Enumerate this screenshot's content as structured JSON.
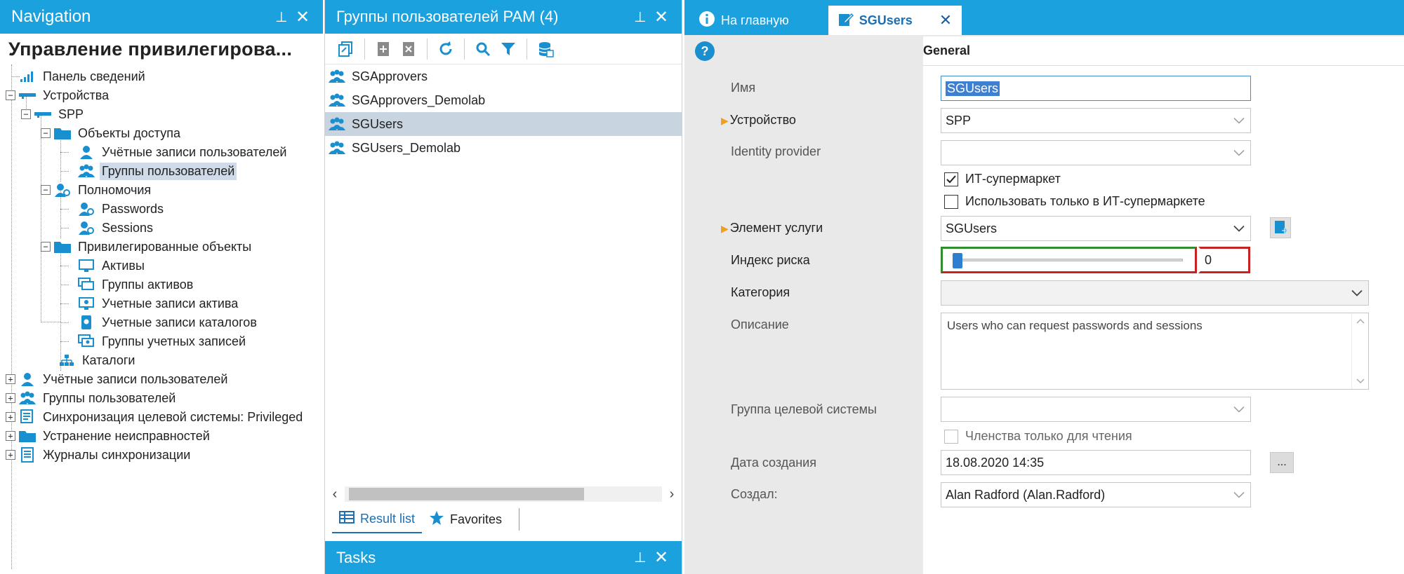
{
  "navigation": {
    "header_title": "Navigation",
    "pin": "⊥",
    "close": "✕",
    "root_title": "Управление привилегирова...",
    "items": [
      {
        "label": "Панель сведений",
        "icon": "dashboard-icon"
      },
      {
        "label": "Устройства",
        "icon": "device-icon"
      },
      {
        "label": "SPP",
        "icon": "device-icon"
      },
      {
        "label": "Объекты доступа",
        "icon": "folder-icon"
      },
      {
        "label": "Учётные записи пользователей",
        "icon": "user-icon"
      },
      {
        "label": "Группы пользователей",
        "icon": "user-group-icon"
      },
      {
        "label": "Полномочия",
        "icon": "entitlement-icon"
      },
      {
        "label": "Passwords",
        "icon": "password-icon"
      },
      {
        "label": "Sessions",
        "icon": "session-icon"
      },
      {
        "label": "Привилегированные объекты",
        "icon": "folder-icon"
      },
      {
        "label": "Активы",
        "icon": "monitor-icon"
      },
      {
        "label": "Группы активов",
        "icon": "monitor-group-icon"
      },
      {
        "label": "Учетные записи актива",
        "icon": "asset-account-icon"
      },
      {
        "label": "Учетные записи каталогов",
        "icon": "directory-account-icon"
      },
      {
        "label": "Группы учетных записей",
        "icon": "account-group-icon"
      },
      {
        "label": "Каталоги",
        "icon": "hierarchy-icon"
      },
      {
        "label": "Учётные записи пользователей",
        "icon": "user-icon"
      },
      {
        "label": "Группы пользователей",
        "icon": "user-group-icon"
      },
      {
        "label": "Синхронизация целевой системы: Privileged",
        "icon": "sync-icon"
      },
      {
        "label": "Устранение неисправностей",
        "icon": "folder-icon"
      },
      {
        "label": "Журналы синхронизации",
        "icon": "log-icon"
      }
    ]
  },
  "results": {
    "header_title": "Группы пользователей PAM (4)",
    "pin": "⊥",
    "close": "✕",
    "items": [
      "SGApprovers",
      "SGApprovers_Demolab",
      "SGUsers",
      "SGUsers_Demolab"
    ],
    "selected_index": 2,
    "scroll_left": "‹",
    "scroll_right": "›",
    "tab_result_list": "Result list",
    "tab_favorites": "Favorites",
    "tasks_title": "Tasks"
  },
  "detail": {
    "tab_home": "На главную",
    "tab_object": "SGUsers",
    "tab_close": "✕",
    "help": "?",
    "section_title": "General",
    "labels": {
      "name": "Имя",
      "device": "Устройство",
      "idp": "Identity provider",
      "service_item": "Элемент услуги",
      "risk_index": "Индекс риска",
      "category": "Категория",
      "description": "Описание",
      "target_group": "Группа целевой системы",
      "created_date": "Дата создания",
      "created_by": "Создал:"
    },
    "values": {
      "name": "SGUsers",
      "device": "SPP",
      "idp": "",
      "service_item": "SGUsers",
      "risk_index": "0",
      "category": "",
      "description": "Users who can request passwords and sessions",
      "target_group": "",
      "created_date": "18.08.2020 14:35",
      "created_by": "Alan Radford (Alan.Radford)"
    },
    "checkboxes": {
      "it_shop": {
        "label": "ИТ-супермаркет",
        "checked": true
      },
      "only_it_shop": {
        "label": "Использовать только в ИТ-супермаркете",
        "checked": false
      },
      "readonly_membership": {
        "label": "Членства только для чтения",
        "checked": false
      }
    },
    "ellipsis_button": "...",
    "risk_slider_level": 0,
    "colors": {
      "accent": "#1aa1de",
      "selection": "#c8d4e0",
      "required_marker": "#f0a020",
      "risk_low": "#2f8f2f",
      "risk_high": "#c52222"
    }
  }
}
